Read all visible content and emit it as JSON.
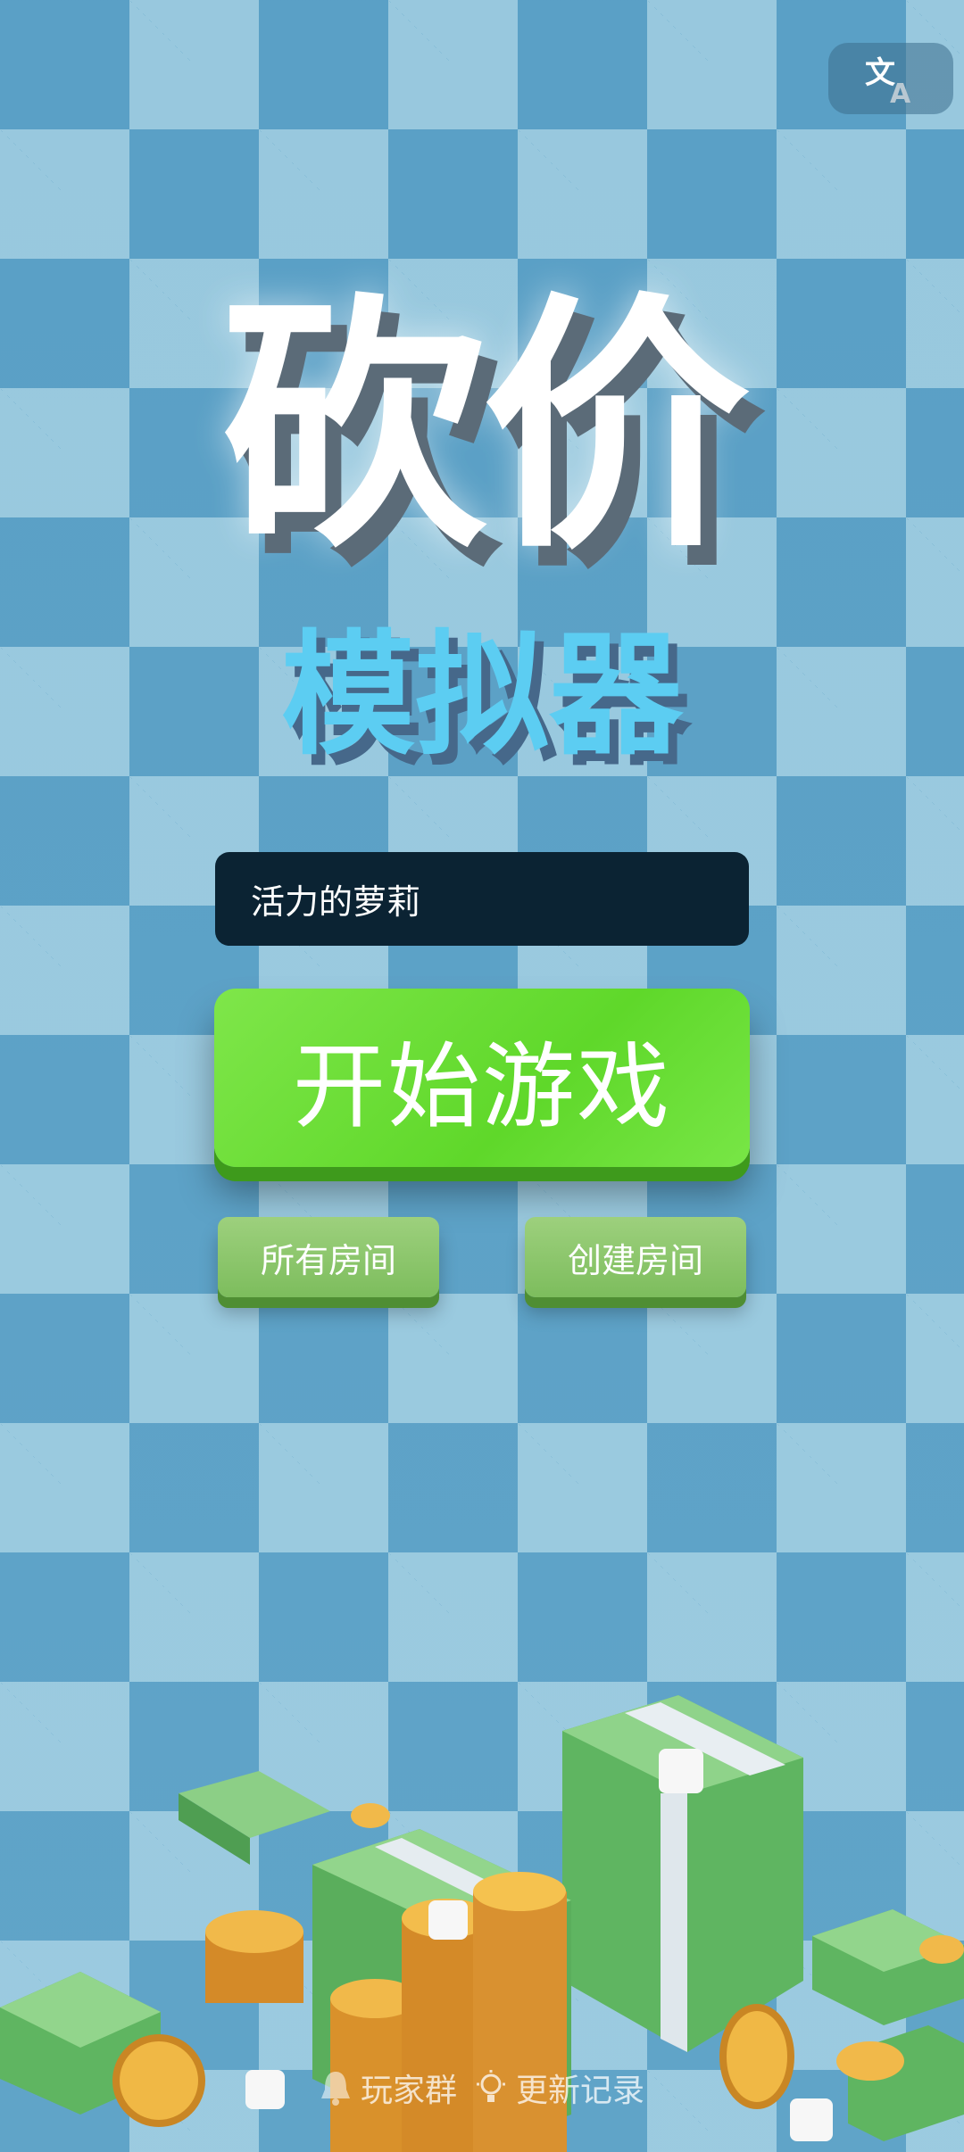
{
  "title": {
    "main": "砍价",
    "sub": "模拟器"
  },
  "player": {
    "name": "活力的萝莉"
  },
  "buttons": {
    "start": "开始游戏",
    "all_rooms": "所有房间",
    "create_room": "创建房间"
  },
  "footer": {
    "group": "玩家群",
    "changelog": "更新记录"
  },
  "icons": {
    "language": "translate-icon",
    "group": "bell-icon",
    "changelog": "lightbulb-icon"
  },
  "colors": {
    "start_button": "#6ee03a",
    "small_button": "#8cc66c",
    "title_sub": "#5ccdf2",
    "input_bg": "#0b2333"
  }
}
